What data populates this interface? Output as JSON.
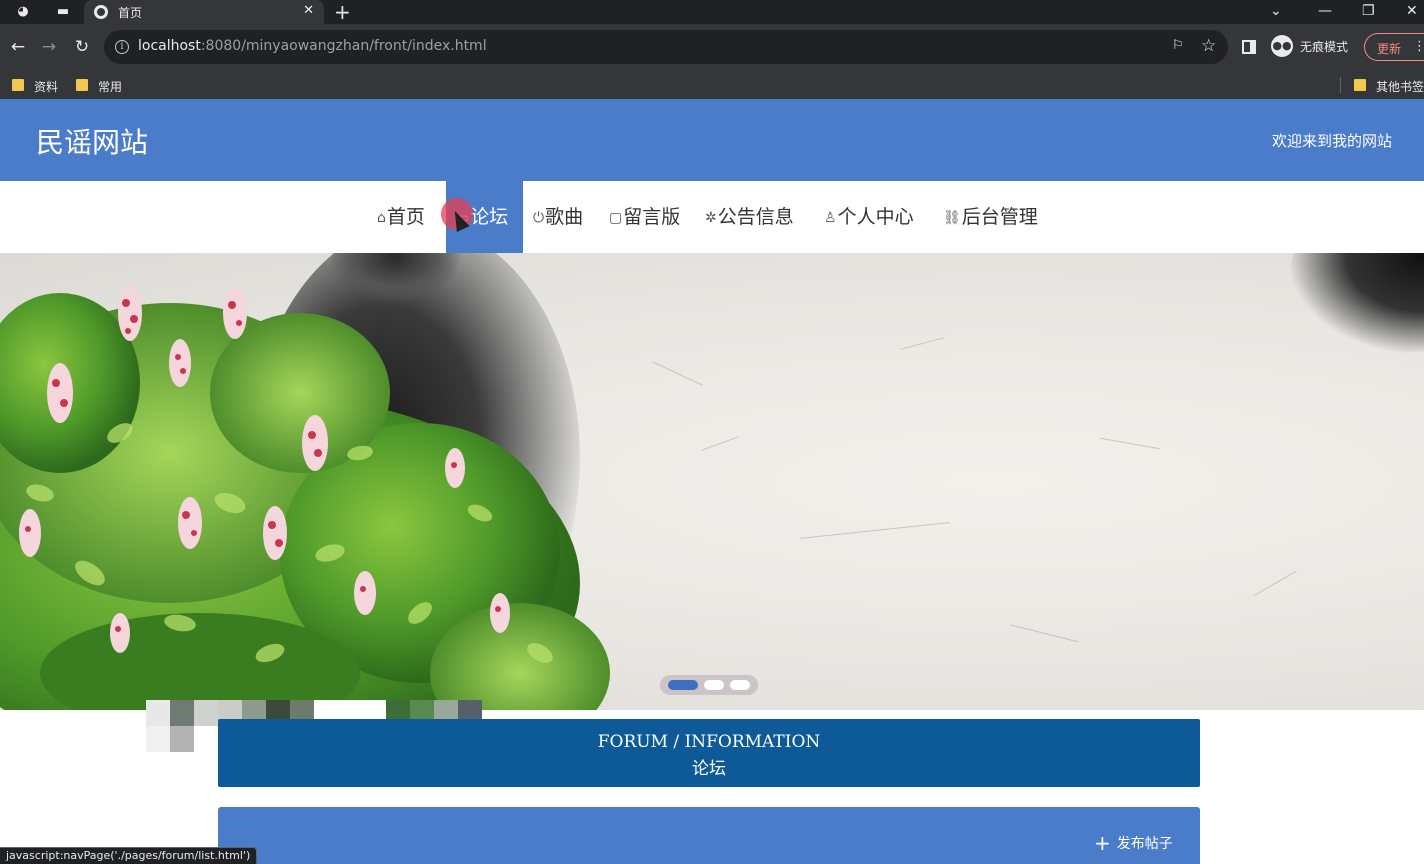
{
  "browser": {
    "tab_title": "首页",
    "url_host": "localhost",
    "url_rest": ":8080/minyaowangzhan/front/index.html",
    "incognito_label": "无痕模式",
    "update_label": "更新",
    "bookmarks": [
      "资料",
      "常用"
    ],
    "other_bookmarks": "其他书签",
    "status_text": "javascript:navPage('./pages/forum/list.html')"
  },
  "site": {
    "logo": "民谣网站",
    "welcome": "欢迎来到我的网站"
  },
  "nav": {
    "items": [
      {
        "label": "首页",
        "icon": "home-icon"
      },
      {
        "label": "论坛",
        "icon": "forum-icon"
      },
      {
        "label": "歌曲",
        "icon": "music-icon"
      },
      {
        "label": "留言版",
        "icon": "message-icon"
      },
      {
        "label": "公告信息",
        "icon": "notice-icon"
      },
      {
        "label": "个人中心",
        "icon": "user-icon"
      },
      {
        "label": "后台管理",
        "icon": "link-icon"
      }
    ],
    "active_index": 1
  },
  "banner": {
    "slide_count": 3,
    "active_slide": 1
  },
  "forum": {
    "title_en": "FORUM / INFORMATION",
    "title_zh": "论坛",
    "publish_label": "发布帖子"
  },
  "colors": {
    "header_bg": "#4a7cc9",
    "forum_title_bg": "#0e5a98",
    "nav_active_bg": "#4a7cc9"
  }
}
